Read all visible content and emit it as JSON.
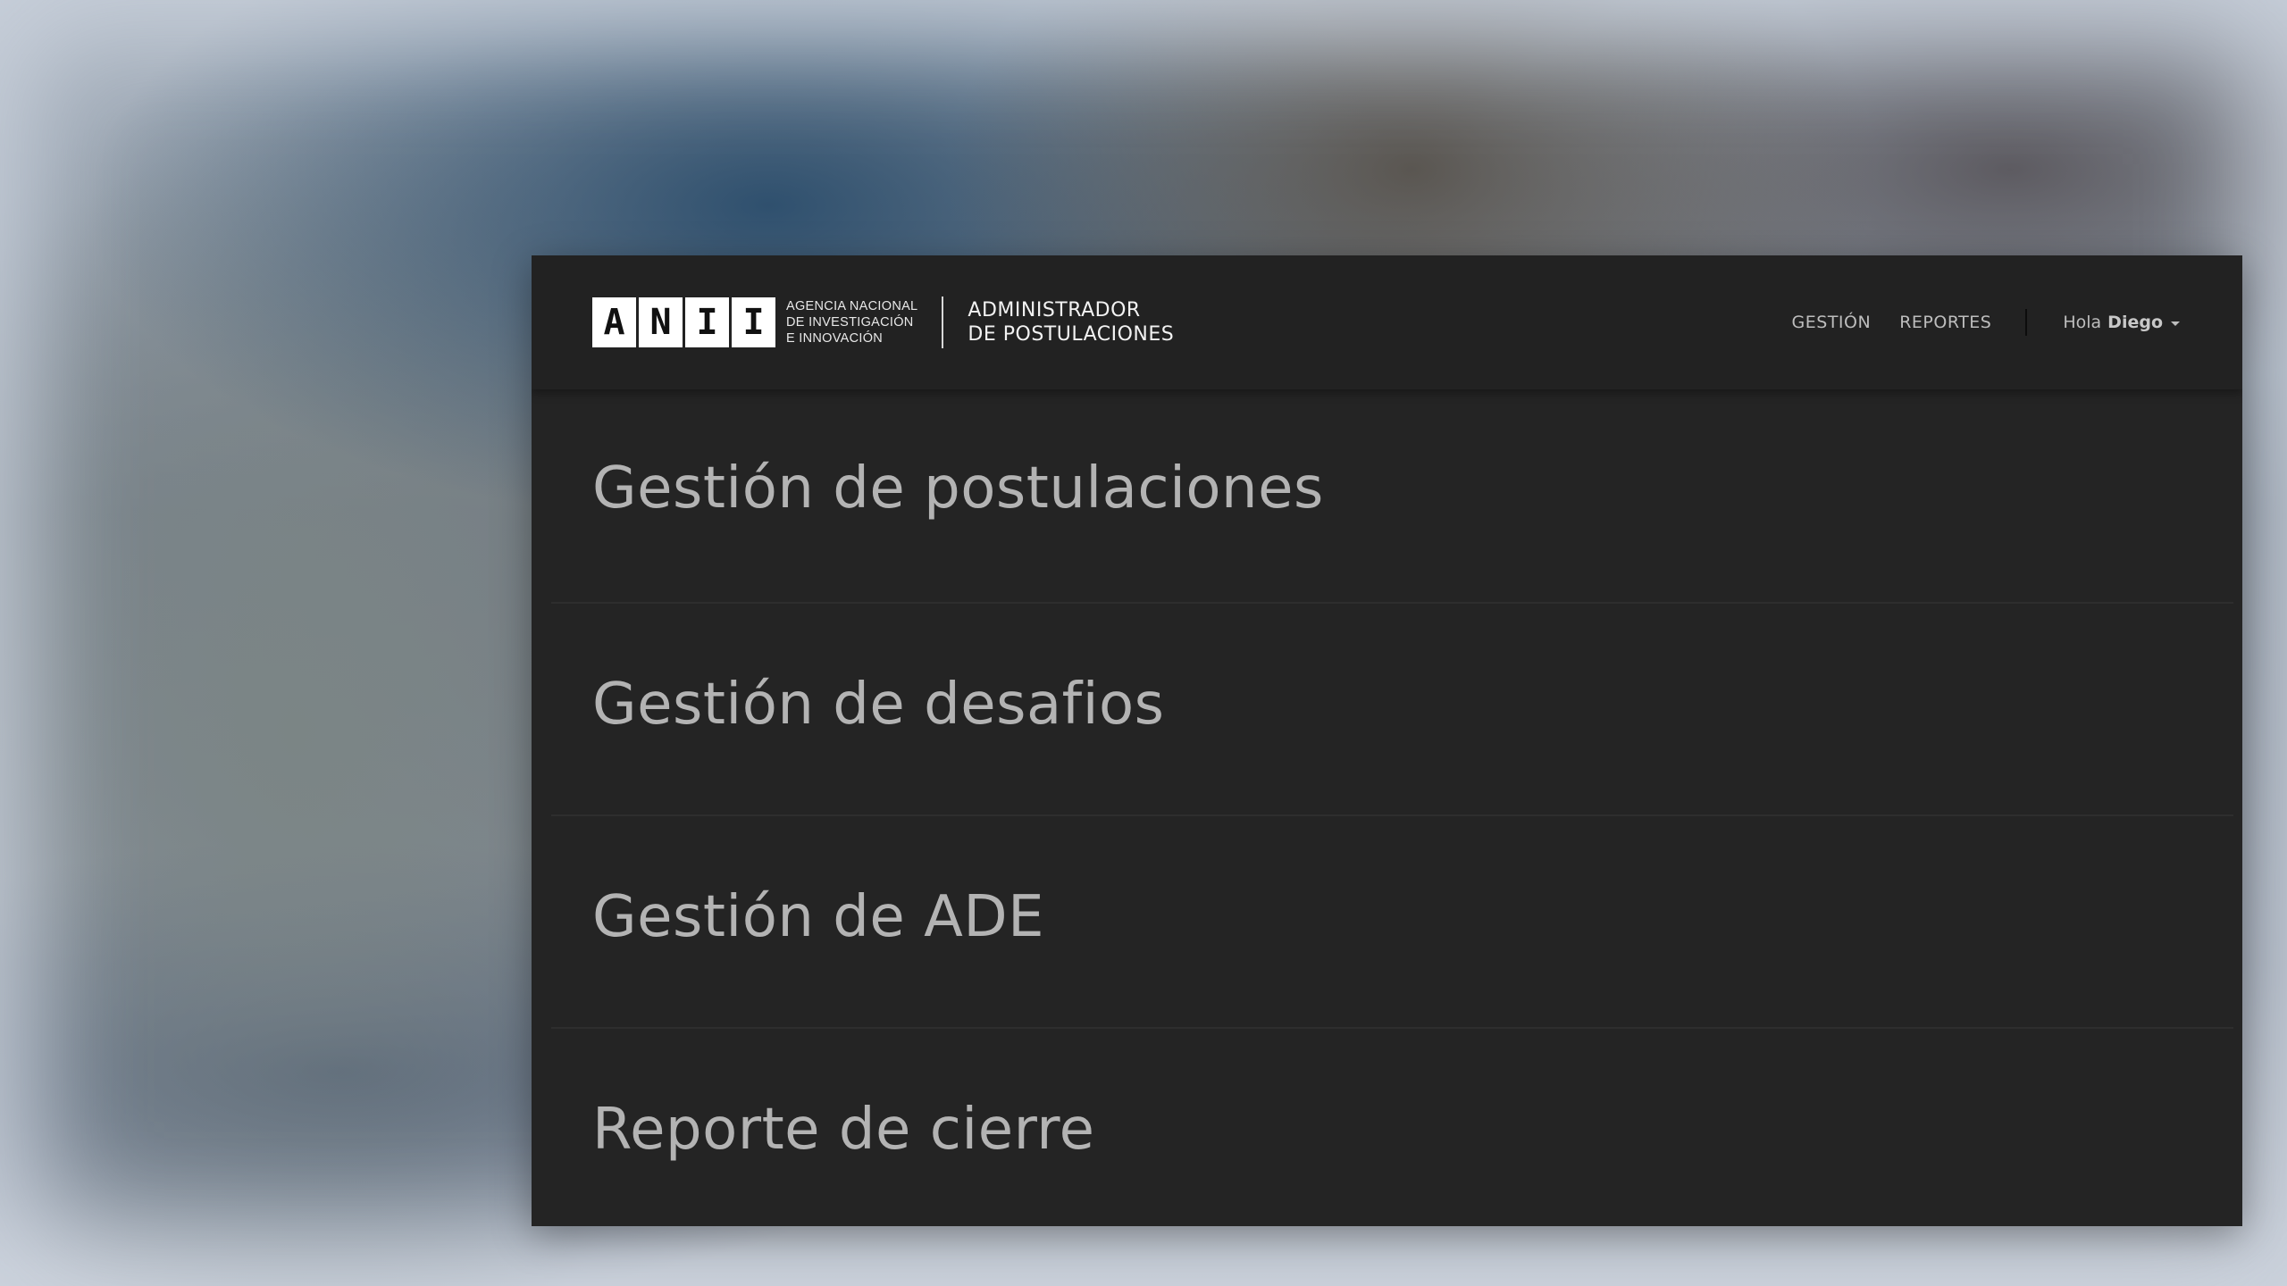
{
  "logo": {
    "letters": [
      "A",
      "N",
      "I",
      "I"
    ],
    "agency_lines": [
      "AGENCIA NACIONAL",
      "DE INVESTIGACIÓN",
      "E INNOVACIÓN"
    ]
  },
  "app_title": {
    "line1": "ADMINISTRADOR",
    "line2": "DE POSTULACIONES"
  },
  "nav": {
    "links": [
      {
        "label": "GESTIÓN"
      },
      {
        "label": "REPORTES"
      }
    ],
    "greeting": "Hola",
    "user_name": "Diego"
  },
  "menu": {
    "items": [
      {
        "label": "Gestión de postulaciones"
      },
      {
        "label": "Gestión de desafios"
      },
      {
        "label": "Gestión de ADE"
      },
      {
        "label": "Reporte de cierre"
      }
    ]
  },
  "colors": {
    "panel_background": "#242424",
    "navbar_background": "#222222",
    "menu_text": "#b3b3b3",
    "logo_box": "#ffffff"
  }
}
